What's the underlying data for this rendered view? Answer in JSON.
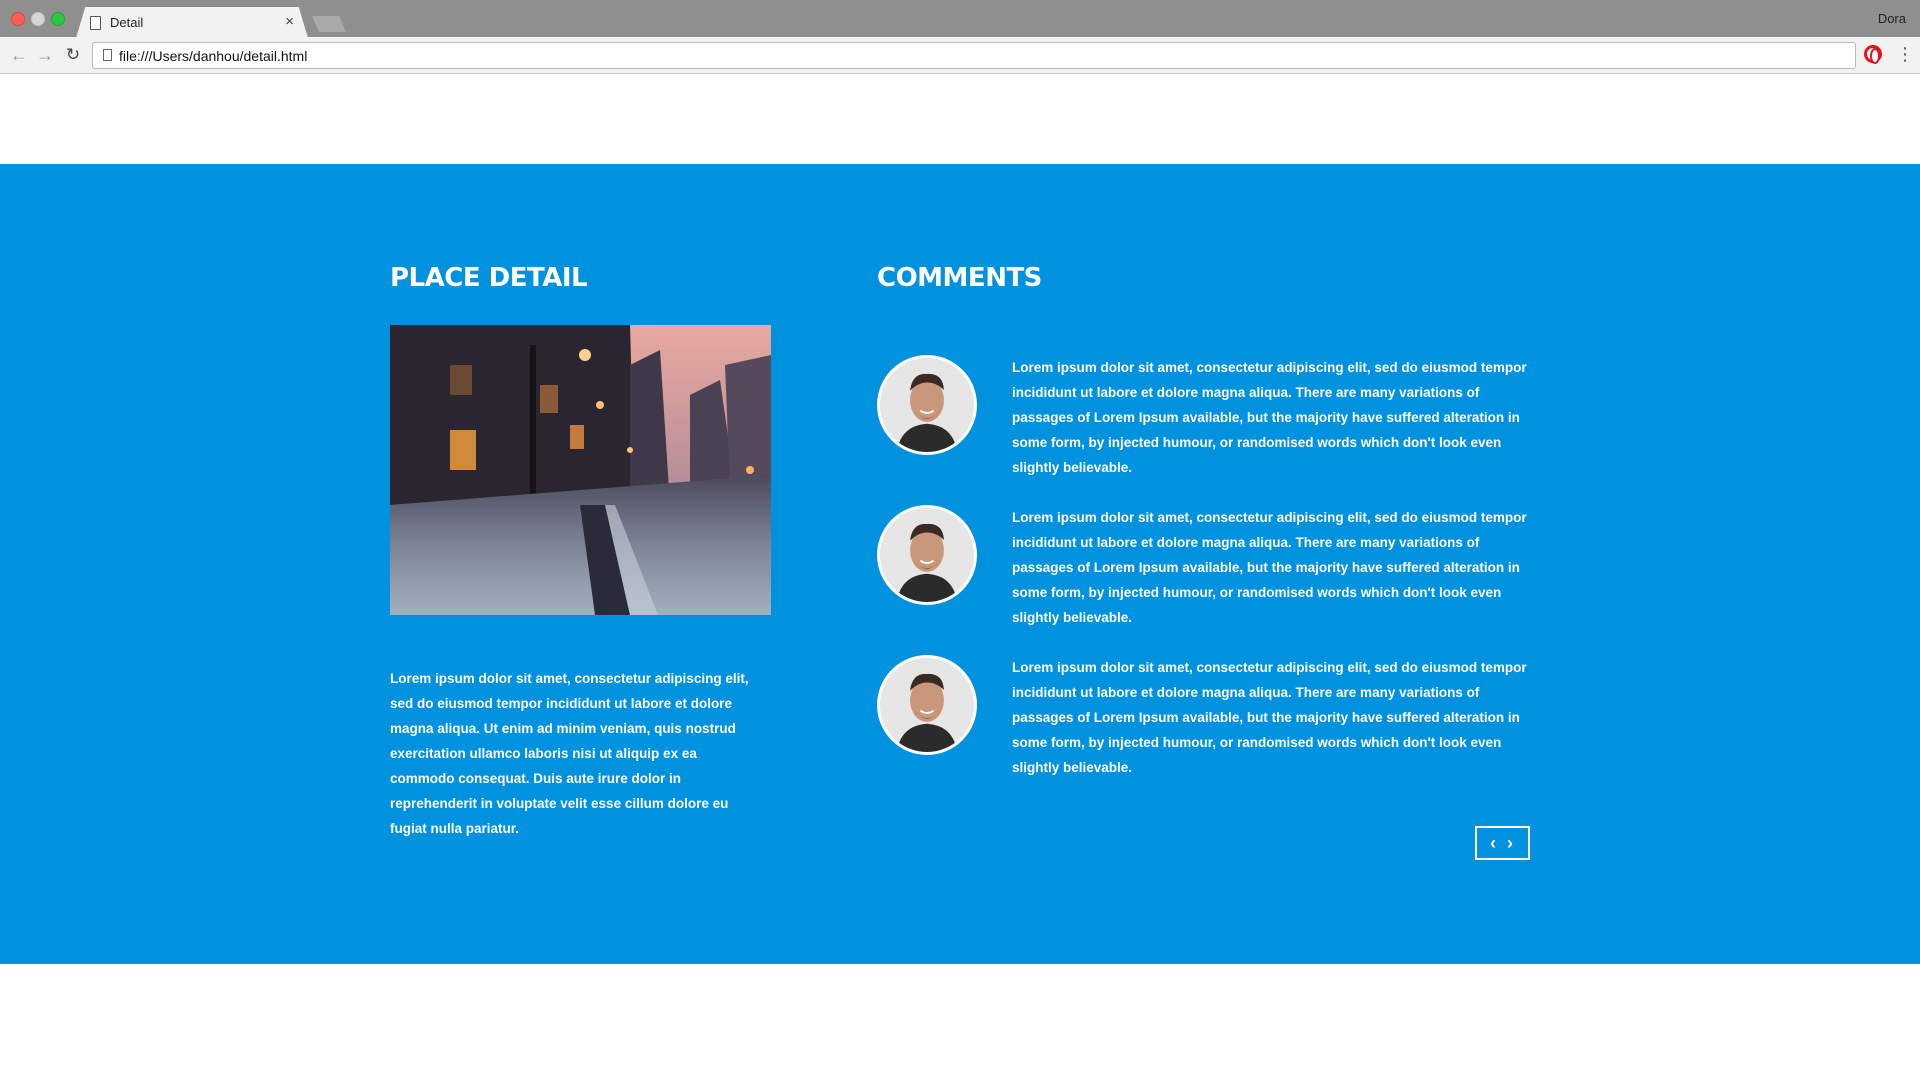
{
  "browser": {
    "tab_title": "Detail",
    "tab_close": "×",
    "profile_name": "Dora",
    "url": "file:///Users/danhou/detail.html",
    "back_glyph": "←",
    "forward_glyph": "→",
    "reload_glyph": "↻",
    "menu_glyph": "⋮"
  },
  "page": {
    "accent_color": "#0091df",
    "place": {
      "title": "PLACE DETAIL",
      "image": "city-street-at-dusk",
      "description": "Lorem ipsum dolor sit amet, consectetur adipiscing elit, sed do eiusmod tempor incididunt ut labore et dolore magna aliqua. Ut enim ad minim veniam, quis nostrud exercitation ullamco laboris nisi ut aliquip ex ea commodo consequat. Duis aute irure dolor in reprehenderit in voluptate velit esse cillum dolore eu fugiat nulla pariatur."
    },
    "comments": {
      "title": "COMMENTS",
      "items": [
        {
          "avatar": "smiling-man-avatar",
          "text": "Lorem ipsum dolor sit amet, consectetur adipiscing elit, sed do eiusmod tempor incididunt ut labore et dolore magna aliqua. There are many variations of passages of Lorem Ipsum available, but the majority have suffered alteration in some form, by injected humour, or randomised words which don't look even slightly believable."
        },
        {
          "avatar": "smiling-man-avatar",
          "text": "Lorem ipsum dolor sit amet, consectetur adipiscing elit, sed do eiusmod tempor incididunt ut labore et dolore magna aliqua. There are many variations of passages of Lorem Ipsum available, but the majority have suffered alteration in some form, by injected humour, or randomised words which don't look even slightly believable."
        },
        {
          "avatar": "smiling-man-avatar",
          "text": "Lorem ipsum dolor sit amet, consectetur adipiscing elit, sed do eiusmod tempor incididunt ut labore et dolore magna aliqua. There are many variations of passages of Lorem Ipsum available, but the majority have suffered alteration in some form, by injected humour, or randomised words which don't look even slightly believable."
        }
      ],
      "pager": {
        "prev": "‹",
        "next": "›"
      }
    }
  }
}
